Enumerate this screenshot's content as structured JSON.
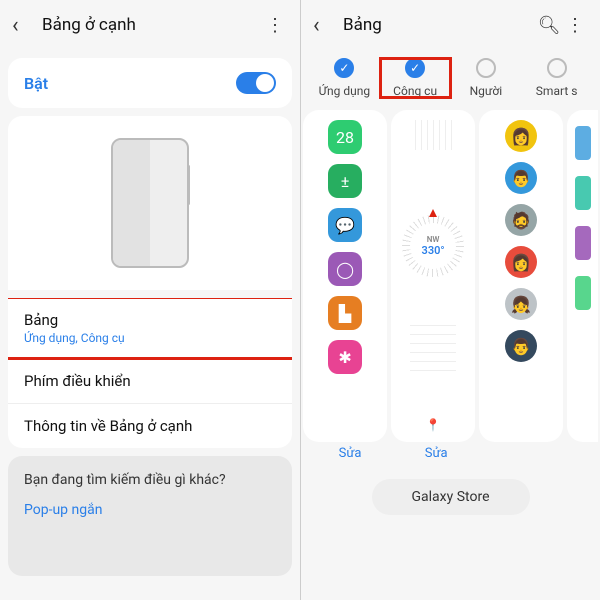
{
  "left": {
    "header_title": "Bảng ở cạnh",
    "toggle_label": "Bật",
    "items": [
      {
        "title": "Bảng",
        "sub": "Ứng dụng, Công cụ"
      },
      {
        "title": "Phím điều khiển"
      },
      {
        "title": "Thông tin về Bảng ở cạnh"
      }
    ],
    "footer_q": "Bạn đang tìm kiếm điều gì khác?",
    "footer_link": "Pop-up ngắn"
  },
  "right": {
    "header_title": "Bảng",
    "tabs": [
      {
        "label": "Ứng dụng",
        "checked": true
      },
      {
        "label": "Công cụ",
        "checked": true,
        "highlight": true
      },
      {
        "label": "Người",
        "checked": false
      },
      {
        "label": "Smart s",
        "checked": false
      }
    ],
    "compass": {
      "label": "NW",
      "deg": "330°"
    },
    "edit_label": "Sửa",
    "store_label": "Galaxy Store",
    "app_colors": [
      "#2ecc71",
      "#27ae60",
      "#3498db",
      "#9b59b6",
      "#e67e22",
      "#e84393"
    ],
    "app_glyphs": [
      "28",
      "±",
      "💬",
      "◯",
      "▙",
      "✱"
    ]
  }
}
